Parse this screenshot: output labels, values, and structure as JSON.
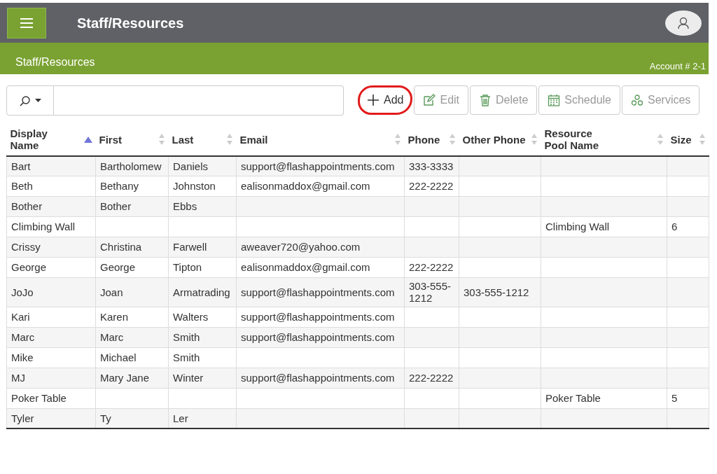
{
  "header": {
    "title": "Staff/Resources"
  },
  "subheader": {
    "title": "Staff/Resources",
    "account": "Account # 2-1"
  },
  "toolbar": [
    {
      "kind": "add",
      "label": "Add",
      "enabled": true,
      "circled": true
    },
    {
      "kind": "edit",
      "label": "Edit",
      "enabled": false,
      "circled": false
    },
    {
      "kind": "delete",
      "label": "Delete",
      "enabled": false,
      "circled": false
    },
    {
      "kind": "schedule",
      "label": "Schedule",
      "enabled": false,
      "circled": false
    },
    {
      "kind": "services",
      "label": "Services",
      "enabled": false,
      "circled": false
    }
  ],
  "table": {
    "columns": [
      {
        "label": "Display Name",
        "sorted": true
      },
      {
        "label": "First",
        "sorted": false
      },
      {
        "label": "Last",
        "sorted": false
      },
      {
        "label": "Email",
        "sorted": false
      },
      {
        "label": "Phone",
        "sorted": false
      },
      {
        "label": "Other Phone",
        "sorted": false
      },
      {
        "label": "Resource Pool Name",
        "sorted": false
      },
      {
        "label": "Size",
        "sorted": false
      }
    ],
    "rows": [
      [
        "Bart",
        "Bartholomew",
        "Daniels",
        "support@flashappointments.com",
        "333-3333",
        "",
        "",
        ""
      ],
      [
        "Beth",
        "Bethany",
        "Johnston",
        "ealisonmaddox@gmail.com",
        "222-2222",
        "",
        "",
        ""
      ],
      [
        "Bother",
        "Bother",
        "Ebbs",
        "",
        "",
        "",
        "",
        ""
      ],
      [
        "Climbing Wall",
        "",
        "",
        "",
        "",
        "",
        "Climbing Wall",
        "6"
      ],
      [
        "Crissy",
        "Christina",
        "Farwell",
        "aweaver720@yahoo.com",
        "",
        "",
        "",
        ""
      ],
      [
        "George",
        "George",
        "Tipton",
        "ealisonmaddox@gmail.com",
        "222-2222",
        "",
        "",
        ""
      ],
      [
        "JoJo",
        "Joan",
        "Armatrading",
        "support@flashappointments.com",
        "303-555-1212",
        "303-555-1212",
        "",
        ""
      ],
      [
        "Kari",
        "Karen",
        "Walters",
        "support@flashappointments.com",
        "",
        "",
        "",
        ""
      ],
      [
        "Marc",
        "Marc",
        "Smith",
        "support@flashappointments.com",
        "",
        "",
        "",
        ""
      ],
      [
        "Mike",
        "Michael",
        "Smith",
        "",
        "",
        "",
        "",
        ""
      ],
      [
        "MJ",
        "Mary Jane",
        "Winter",
        "support@flashappointments.com",
        "222-2222",
        "",
        "",
        ""
      ],
      [
        "Poker Table",
        "",
        "",
        "",
        "",
        "",
        "Poker Table",
        "5"
      ],
      [
        "Tyler",
        "Ty",
        "Ler",
        "",
        "",
        "",
        "",
        ""
      ]
    ]
  }
}
